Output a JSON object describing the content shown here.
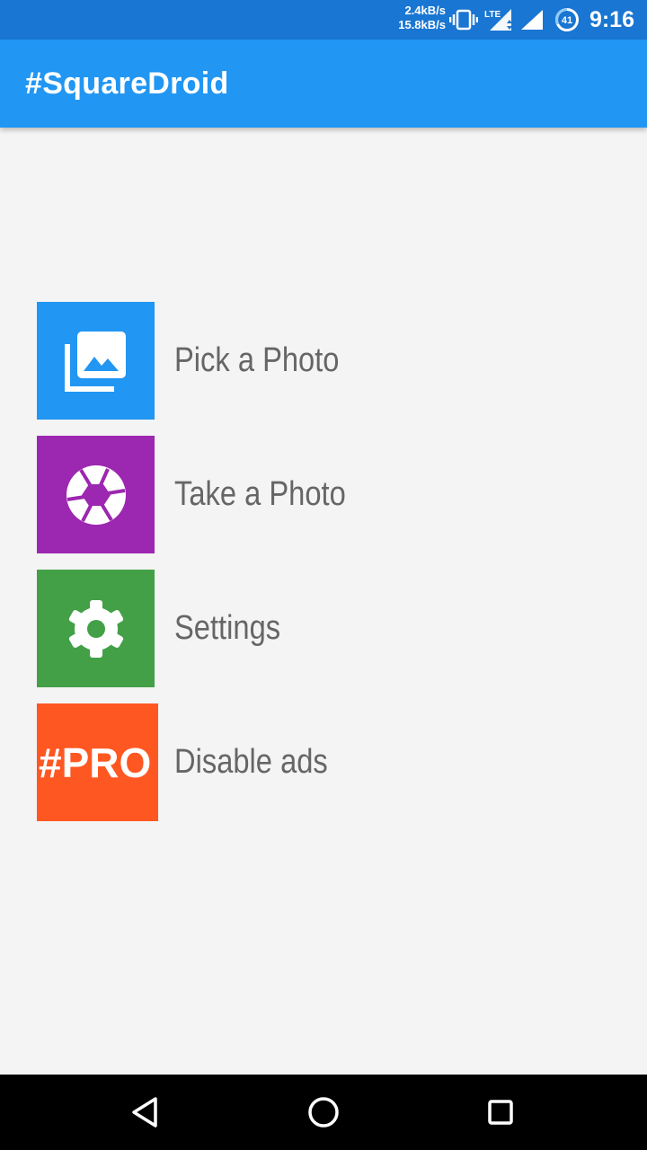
{
  "status_bar": {
    "upload_speed": "2.4kB/s",
    "download_speed": "15.8kB/s",
    "network_type": "LTE",
    "battery_level": "41",
    "time": "9:16"
  },
  "app_bar": {
    "title": "#SquareDroid"
  },
  "menu": [
    {
      "label": "Pick a Photo",
      "color": "#2196f3",
      "icon": "photo-library-icon"
    },
    {
      "label": "Take a Photo",
      "color": "#9c27b0",
      "icon": "camera-shutter-icon"
    },
    {
      "label": "Settings",
      "color": "#43a047",
      "icon": "gear-icon"
    },
    {
      "label": "Disable ads",
      "color": "#ff5722",
      "badge": "#PRO"
    }
  ],
  "nav_bar": {
    "buttons": [
      "back-icon",
      "home-icon",
      "recents-icon"
    ]
  }
}
